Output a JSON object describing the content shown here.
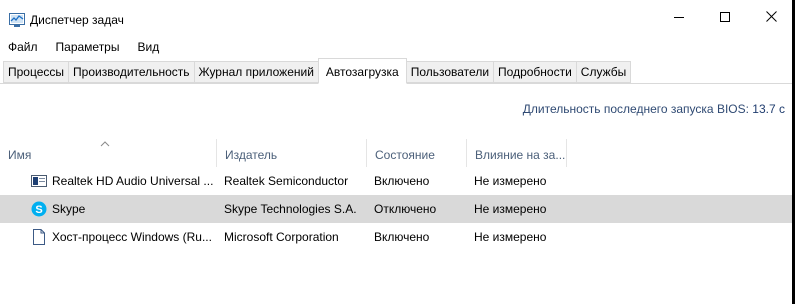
{
  "window": {
    "title": "Диспетчер задач"
  },
  "titlebar_icons": {
    "app": "task-manager-icon",
    "minimize": "minimize-icon",
    "maximize": "maximize-icon",
    "close": "close-icon"
  },
  "menu": [
    "Файл",
    "Параметры",
    "Вид"
  ],
  "tabs": [
    "Процессы",
    "Производительность",
    "Журнал приложений",
    "Автозагрузка",
    "Пользователи",
    "Подробности",
    "Службы"
  ],
  "active_tab": "Автозагрузка",
  "bios": {
    "label": "Длительность последнего запуска BIOS:",
    "value": "13.7 с"
  },
  "table": {
    "sorted_column": "Имя",
    "columns": [
      "Имя",
      "Издатель",
      "Состояние",
      "Влияние на за..."
    ],
    "rows": [
      {
        "icon": "realtek-audio-icon",
        "name": "Realtek HD Audio Universal ...",
        "publisher": "Realtek Semiconductor",
        "state": "Включено",
        "impact": "Не измерено",
        "selected": false
      },
      {
        "icon": "skype-icon",
        "name": "Skype",
        "publisher": "Skype Technologies S.A.",
        "state": "Отключено",
        "impact": "Не измерено",
        "selected": true
      },
      {
        "icon": "document-icon",
        "name": "Хост-процесс Windows (Ru...",
        "publisher": "Microsoft Corporation",
        "state": "Включено",
        "impact": "Не измерено",
        "selected": false
      }
    ]
  },
  "colors": {
    "selected_row": "#d9d9d9",
    "header_text": "#4c607a",
    "bios_text": "#2f4a73",
    "skype_blue": "#00aff0"
  }
}
